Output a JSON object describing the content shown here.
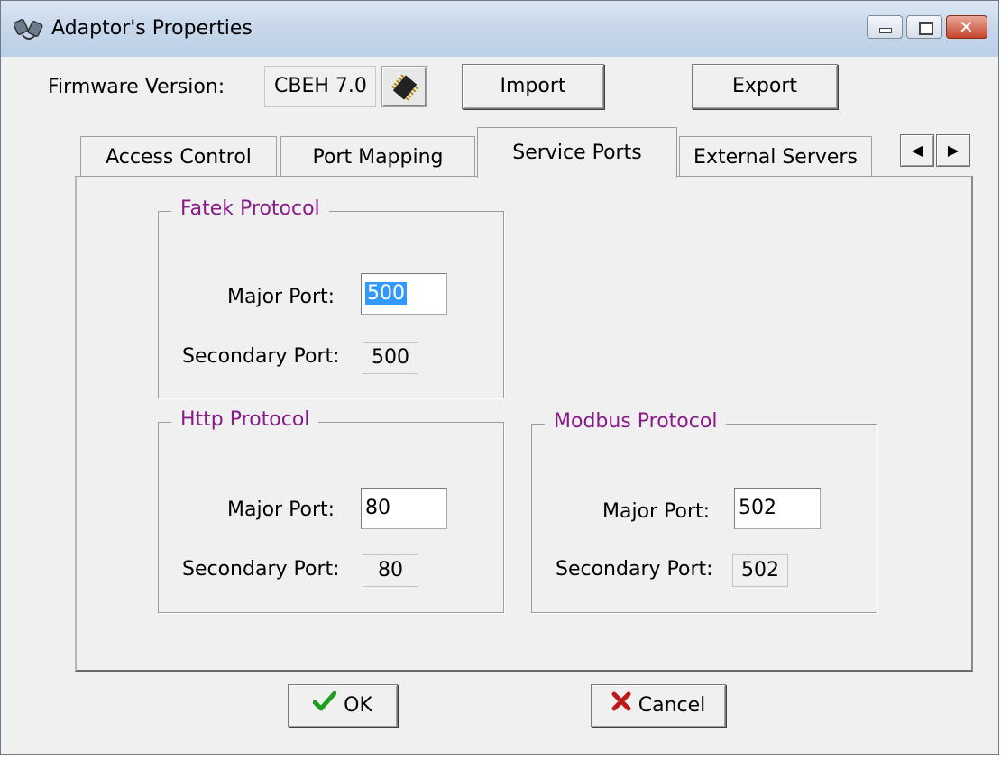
{
  "window": {
    "title": "Adaptor's Properties",
    "icon": "network-adapter-icon",
    "controls": [
      "minimize-icon",
      "maximize-icon",
      "close-icon"
    ],
    "close_glyph": "✕"
  },
  "firmware": {
    "label": "Firmware Version:",
    "value": "CBEH 7.0",
    "chip_icon": "chip-icon"
  },
  "toolbar": {
    "import_label": "Import",
    "export_label": "Export"
  },
  "tabs": [
    {
      "label": "Access Control",
      "active": false
    },
    {
      "label": "Port Mapping",
      "active": false
    },
    {
      "label": "Service Ports",
      "active": true
    },
    {
      "label": "External Servers",
      "active": false
    }
  ],
  "tab_scroll": {
    "left": "◀",
    "right": "▶"
  },
  "groups": {
    "fatek": {
      "title": "Fatek Protocol",
      "major_label": "Major Port:",
      "major_value": "500",
      "secondary_label": "Secondary Port:",
      "secondary_value": "500"
    },
    "http": {
      "title": "Http Protocol",
      "major_label": "Major Port:",
      "major_value": "80",
      "secondary_label": "Secondary Port:",
      "secondary_value": "80"
    },
    "modbus": {
      "title": "Modbus Protocol",
      "major_label": "Major Port:",
      "major_value": "502",
      "secondary_label": "Secondary Port:",
      "secondary_value": "502"
    }
  },
  "footer": {
    "ok_label": "OK",
    "ok_icon": "checkmark-icon",
    "cancel_label": "Cancel",
    "cancel_icon": "x-icon"
  },
  "colors": {
    "group_title": "#8a1a8a",
    "selection": "#3399ff",
    "ok_check": "#1e9e1e",
    "cancel_x": "#c01818"
  }
}
